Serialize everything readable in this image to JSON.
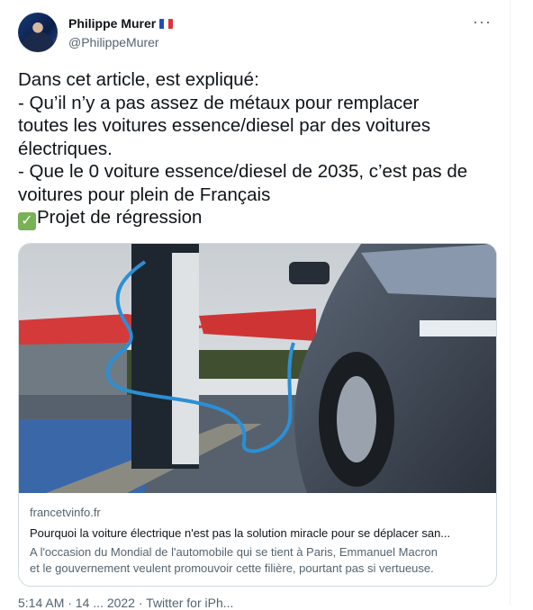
{
  "tweet": {
    "author_name": "Philippe Murer",
    "author_handle": "@PhilippeMurer",
    "more_icon": "more-dots-icon",
    "lines": [
      "Dans cet article, est expliqué:",
      "- Qu’il n’y a pas assez de métaux pour remplacer",
      "toutes les voitures essence/diesel par des voitures",
      "électriques.",
      "- Que le 0 voiture essence/diesel de 2035, c’est pas de",
      "voitures pour plein de Français"
    ],
    "last_line_text": "Projet de régression",
    "check_icon": "check-mark-button-icon",
    "timestamp_partial": "5:14 AM · 14 ... 2022 · Twitter for iPh..."
  },
  "card": {
    "domain": "francetvinfo.fr",
    "title": "Pourquoi la voiture électrique n'est pas la solution miracle pour se déplacer san...",
    "description_line1": "A l'occasion du Mondial de l'automobile qui se tient à Paris, Emmanuel Macron",
    "description_line2": "et le gouvernement veulent promouvoir cette filière, pourtant pas si vertueuse.",
    "image_subject": "electric car charging at a station"
  },
  "colors": {
    "text": "#0f1419",
    "secondary": "#536471",
    "border": "#cfd9de",
    "check_green": "#77b255"
  }
}
